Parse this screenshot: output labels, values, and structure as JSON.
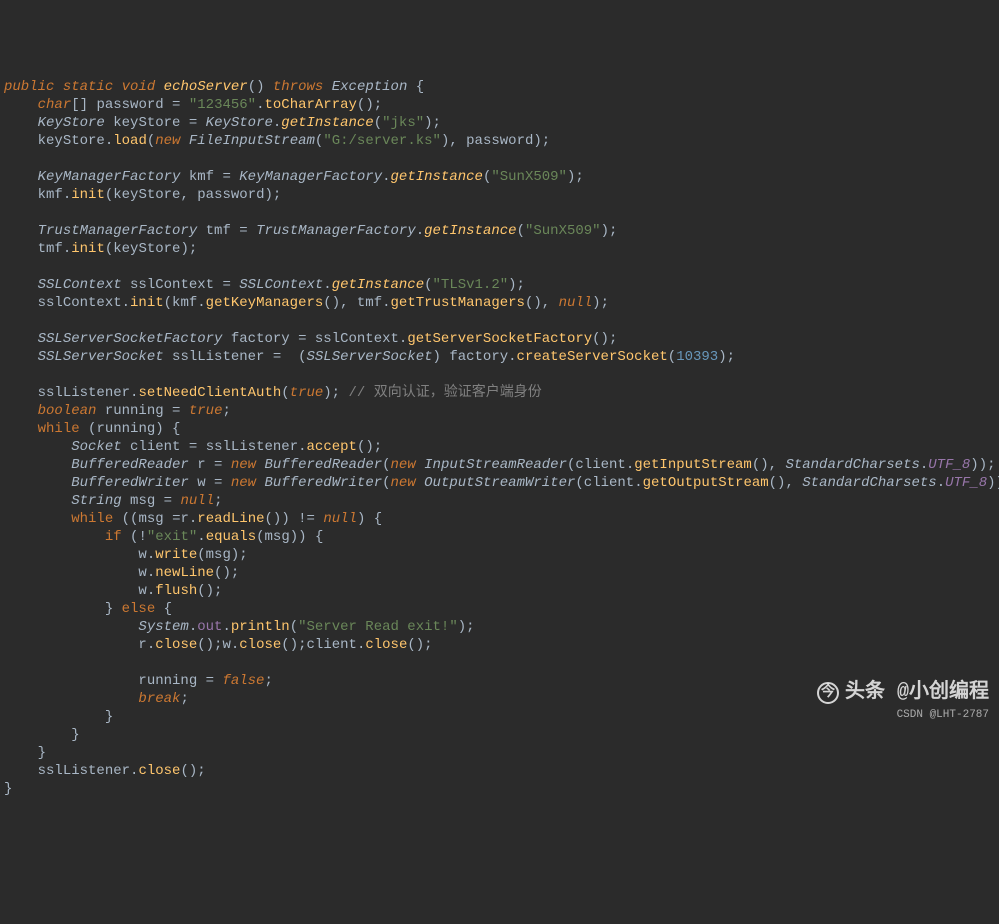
{
  "watermark": {
    "top": "头条 @小创编程",
    "bottom": "CSDN @LHT-2787"
  },
  "code": {
    "l1a": "public",
    "l1b": "static",
    "l1c": "void",
    "l1d": "echoServer",
    "l1e": "throws",
    "l1f": "Exception",
    "l2a": "char",
    "l2b": "password",
    "l2c": "\"123456\"",
    "l2d": "toCharArray",
    "l3a": "KeyStore",
    "l3b": "keyStore",
    "l3c": "KeyStore",
    "l3d": "getInstance",
    "l3e": "\"jks\"",
    "l4a": "keyStore",
    "l4b": "load",
    "l4c": "new",
    "l4d": "FileInputStream",
    "l4e": "\"G:/server.ks\"",
    "l4f": "password",
    "l5a": "KeyManagerFactory",
    "l5b": "kmf",
    "l5c": "KeyManagerFactory",
    "l5d": "getInstance",
    "l5e": "\"SunX509\"",
    "l6a": "kmf",
    "l6b": "init",
    "l6c": "keyStore",
    "l6d": "password",
    "l7a": "TrustManagerFactory",
    "l7b": "tmf",
    "l7c": "TrustManagerFactory",
    "l7d": "getInstance",
    "l7e": "\"SunX509\"",
    "l8a": "tmf",
    "l8b": "init",
    "l8c": "keyStore",
    "l9a": "SSLContext",
    "l9b": "sslContext",
    "l9c": "SSLContext",
    "l9d": "getInstance",
    "l9e": "\"TLSv1.2\"",
    "l10a": "sslContext",
    "l10b": "init",
    "l10c": "kmf",
    "l10d": "getKeyManagers",
    "l10e": "tmf",
    "l10f": "getTrustManagers",
    "l10g": "null",
    "l11a": "SSLServerSocketFactory",
    "l11b": "factory",
    "l11c": "sslContext",
    "l11d": "getServerSocketFactory",
    "l12a": "SSLServerSocket",
    "l12b": "sslListener",
    "l12c": "SSLServerSocket",
    "l12d": "factory",
    "l12e": "createServerSocket",
    "l12f": "10393",
    "l13a": "sslListener",
    "l13b": "setNeedClientAuth",
    "l13c": "true",
    "l13d": "// 双向认证，验证客户端身份",
    "l14a": "boolean",
    "l14b": "running",
    "l14c": "true",
    "l15a": "while",
    "l15b": "running",
    "l16a": "Socket",
    "l16b": "client",
    "l16c": "sslListener",
    "l16d": "accept",
    "l17a": "BufferedReader",
    "l17b": "r",
    "l17c": "new",
    "l17d": "BufferedReader",
    "l17e": "new",
    "l17f": "InputStreamReader",
    "l17g": "client",
    "l17h": "getInputStream",
    "l17i": "StandardCharsets",
    "l17j": "UTF_8",
    "l18a": "BufferedWriter",
    "l18b": "w",
    "l18c": "new",
    "l18d": "BufferedWriter",
    "l18e": "new",
    "l18f": "OutputStreamWriter",
    "l18g": "client",
    "l18h": "getOutputStream",
    "l18i": "StandardCharsets",
    "l18j": "UTF_8",
    "l19a": "String",
    "l19b": "msg",
    "l19c": "null",
    "l20a": "while",
    "l20b": "msg",
    "l20c": "r",
    "l20d": "readLine",
    "l20e": "null",
    "l21a": "if",
    "l21b": "\"exit\"",
    "l21c": "equals",
    "l21d": "msg",
    "l22a": "w",
    "l22b": "write",
    "l22c": "msg",
    "l23a": "w",
    "l23b": "newLine",
    "l24a": "w",
    "l24b": "flush",
    "l25a": "else",
    "l26a": "System",
    "l26b": "out",
    "l26c": "println",
    "l26d": "\"Server Read exit!\"",
    "l27a": "r",
    "l27b": "close",
    "l27c": "w",
    "l27d": "close",
    "l27e": "client",
    "l27f": "close",
    "l28a": "running",
    "l28b": "false",
    "l29a": "break",
    "l30a": "sslListener",
    "l30b": "close"
  }
}
